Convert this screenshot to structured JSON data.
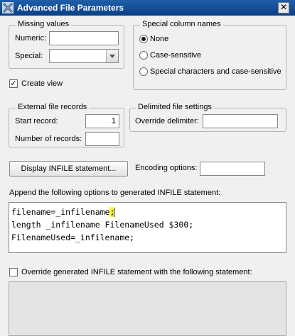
{
  "window": {
    "title": "Advanced File Parameters",
    "close_symbol": "✕"
  },
  "missing_values": {
    "legend": "Missing values",
    "numeric_label": "Numeric:",
    "numeric_value": "",
    "special_label": "Special:",
    "special_value": ""
  },
  "special_column_names": {
    "legend": "Special column names",
    "options": [
      "None",
      "Case-sensitive",
      "Special characters and case-sensitive"
    ],
    "selected": "None"
  },
  "create_view": {
    "label": "Create view",
    "checked": true,
    "mark": "✓"
  },
  "external_file_records": {
    "legend": "External file records",
    "start_label": "Start record:",
    "start_value": "1",
    "number_label": "Number of records:",
    "number_value": ""
  },
  "delimited": {
    "legend": "Delimited file settings",
    "override_label": "Override delimiter:",
    "override_value": ""
  },
  "display_button": "Display INFILE statement...",
  "encoding": {
    "label": "Encoding options:",
    "value": ""
  },
  "append": {
    "label": "Append the following options to generated INFILE statement:",
    "line1_pre": "filename=_infilename",
    "line1_hl": ";",
    "line2": "length _infilename FilenameUsed $300;",
    "line3": "FilenameUsed=_infilename;"
  },
  "override": {
    "label": "Override generated INFILE statement with the following statement:",
    "checked": false
  }
}
